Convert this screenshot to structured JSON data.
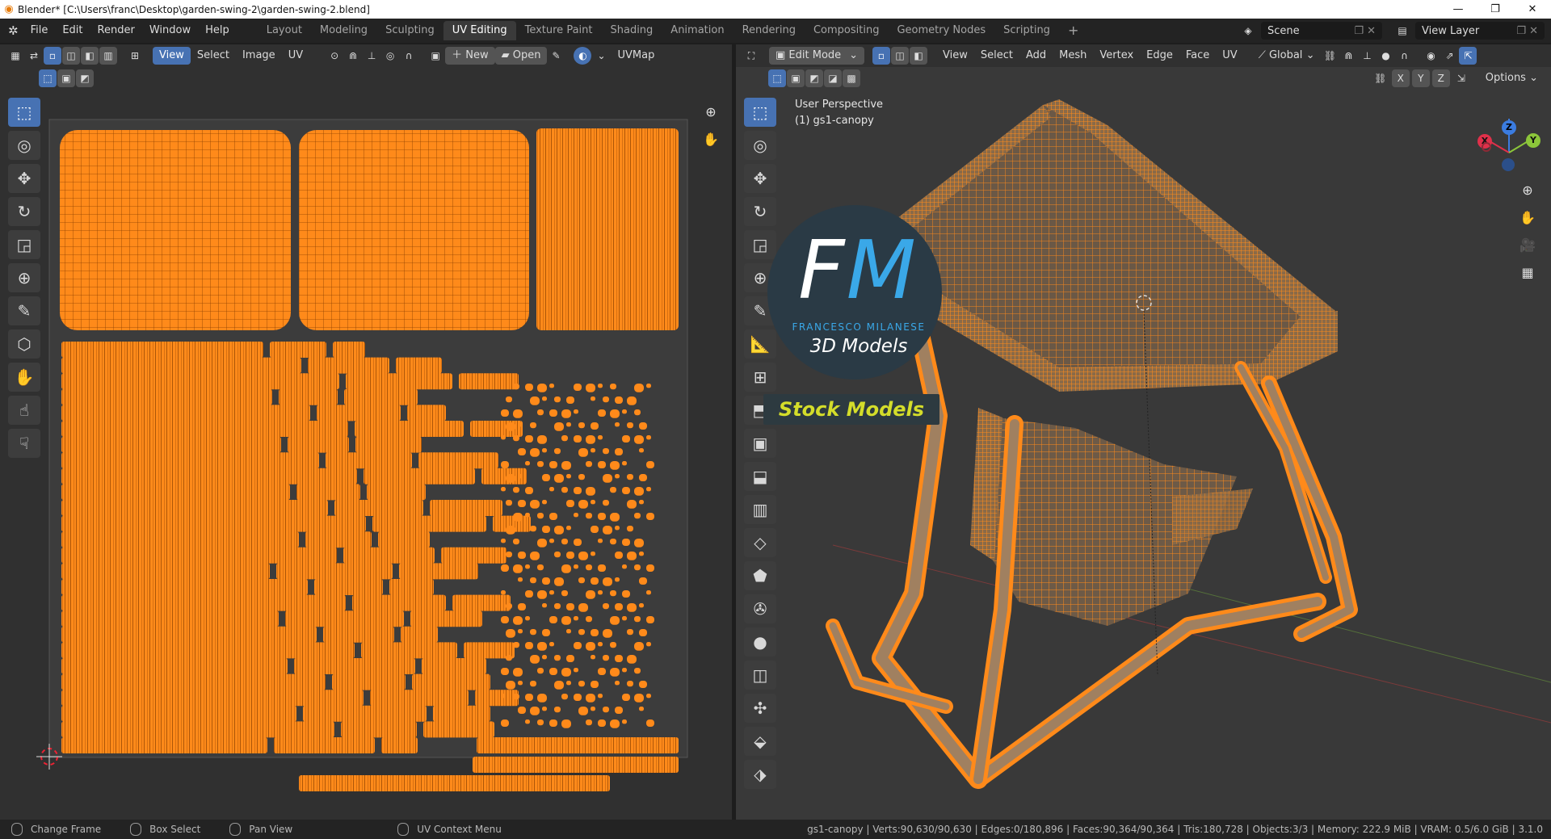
{
  "window": {
    "title": "Blender* [C:\\Users\\franc\\Desktop\\garden-swing-2\\garden-swing-2.blend]",
    "controls": [
      "—",
      "❐",
      "✕"
    ]
  },
  "menubar": {
    "items": [
      "File",
      "Edit",
      "Render",
      "Window",
      "Help"
    ]
  },
  "workspaces": {
    "tabs": [
      "Layout",
      "Modeling",
      "Sculpting",
      "UV Editing",
      "Texture Paint",
      "Shading",
      "Animation",
      "Rendering",
      "Compositing",
      "Geometry Nodes",
      "Scripting"
    ],
    "active": "UV Editing",
    "add": "+"
  },
  "scene": {
    "name": "Scene",
    "view_layer": "View Layer"
  },
  "uv_editor": {
    "menus": [
      "View",
      "Select",
      "Image",
      "UV"
    ],
    "active_menu": "View",
    "new_label": "New",
    "open_label": "Open",
    "uvmap_label": "UVMap",
    "tools": [
      "select-box",
      "cursor",
      "move",
      "rotate",
      "scale",
      "transform",
      "annotate",
      "rip",
      "grab",
      "relax",
      "pinch"
    ]
  },
  "viewport": {
    "mode": "Edit Mode",
    "menus": [
      "View",
      "Select",
      "Add",
      "Mesh",
      "Vertex",
      "Edge",
      "Face",
      "UV"
    ],
    "orientation": "Global",
    "axes": [
      "X",
      "Y",
      "Z"
    ],
    "options_label": "Options",
    "perspective_label": "User Perspective",
    "object_label": "(1) gs1-canopy",
    "tools": [
      "select-box",
      "cursor",
      "move",
      "rotate",
      "scale",
      "transform",
      "annotate",
      "measure",
      "add-cube",
      "extrude",
      "inset",
      "bevel",
      "loop-cut",
      "knife",
      "poly-build",
      "spin",
      "smooth",
      "edge-slide",
      "shrink",
      "shear",
      "rip-region"
    ]
  },
  "gizmo": {
    "x": "X",
    "y": "Y",
    "z": "Z"
  },
  "watermark": {
    "fm_f": "F",
    "fm_m": "M",
    "name": "FRANCESCO MILANESE",
    "sub": "3D Models",
    "stock": "Stock Models"
  },
  "statusbar": {
    "items": [
      "Change Frame",
      "Box Select",
      "Pan View",
      "UV Context Menu"
    ],
    "stats": "gs1-canopy | Verts:90,630/90,630 | Edges:0/180,896 | Faces:90,364/90,364 | Tris:180,728 | Objects:3/3 | Memory: 222.9 MiB | VRAM: 0.5/6.0 GiB | 3.1.0"
  },
  "colors": {
    "accent": "#4772b3",
    "mesh_orange": "#ff8a1a",
    "watermark_blue": "#3aa8e8",
    "stock_yellow": "#d4dd2a"
  }
}
